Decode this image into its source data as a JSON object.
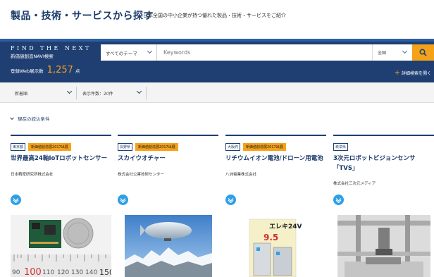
{
  "header": {
    "title": "製品・技術・サービスから探す",
    "description": "日本全国の中小企業が持つ優れた製品・技術・サービスをご紹介"
  },
  "search": {
    "brand_en": "FIND THE NEXT",
    "brand_jp": "新価値創造NAVI検索",
    "theme_label": "すべてのテーマ",
    "keyword_placeholder": "Keywords",
    "area_label": "全国",
    "count_label": "登録Web展示数",
    "count_value": "1,257",
    "count_unit": "点",
    "advanced_label": "詳細検索を開く"
  },
  "sort": {
    "order_label": "新着順",
    "perpage_label": "表示件数：20件"
  },
  "filter_label": "現在の絞込条件",
  "cards": [
    {
      "pref": "東京都",
      "award": "新価値創造展2017出展",
      "title": "世界最高24軸IoTロボットセンサー",
      "company": "日本精密研究所株式会社"
    },
    {
      "pref": "長野県",
      "award": "新価値創造展2017出展",
      "title": "スカイウオチャー",
      "company": "株式会社公害技術センター"
    },
    {
      "pref": "大阪府",
      "award": "新価値創造展2017出展",
      "title": "リチウムイオン電池/ドローン用電池",
      "company": "八洲電業株式会社",
      "img_text1": "エレキ24V",
      "img_text2": "9.5"
    },
    {
      "pref": "岐阜県",
      "award": "",
      "title": "3次元ロボットビジョンセンサ「TVS」",
      "company": "株式会社三次元メディア"
    }
  ],
  "ruler_labels": [
    "90",
    "100",
    "110",
    "120",
    "130",
    "140",
    "150"
  ],
  "colors": {
    "navy": "#1f3f73",
    "accent": "#f5a21b",
    "icon_blue": "#2f9fe6"
  }
}
